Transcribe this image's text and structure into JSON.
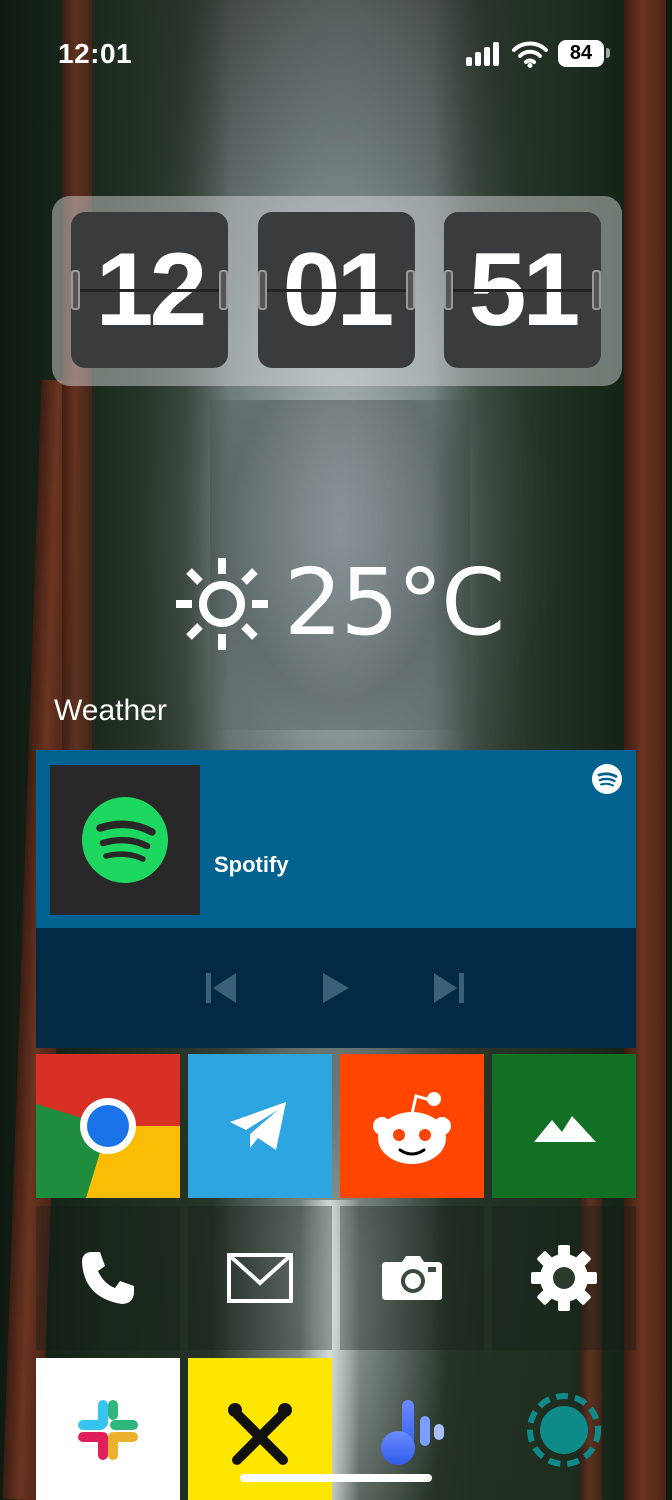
{
  "status_bar": {
    "time": "12:01",
    "battery": "84"
  },
  "flip_clock": {
    "hours": "12",
    "minutes": "01",
    "seconds": "51"
  },
  "weather": {
    "temperature": "25°C",
    "condition_icon": "sun-icon",
    "label": "Weather"
  },
  "spotify": {
    "title": "Spotify",
    "controls": [
      "previous-icon",
      "play-icon",
      "next-icon"
    ],
    "colors": {
      "header": "#02628f",
      "controls_bg": "#022a44",
      "brand": "#1ed760"
    }
  },
  "apps": [
    {
      "name": "chrome",
      "icon": "chrome-icon"
    },
    {
      "name": "telegram",
      "icon": "telegram-icon",
      "color": "#2ca5e0"
    },
    {
      "name": "reddit",
      "icon": "reddit-icon",
      "color": "#ff4500"
    },
    {
      "name": "mountains",
      "icon": "mountain-icon",
      "color": "#117024"
    },
    {
      "name": "phone",
      "icon": "phone-icon"
    },
    {
      "name": "mail",
      "icon": "mail-icon"
    },
    {
      "name": "camera",
      "icon": "camera-icon"
    },
    {
      "name": "settings",
      "icon": "gear-icon"
    },
    {
      "name": "slack",
      "icon": "slack-icon",
      "color": "#ffffff"
    },
    {
      "name": "raiffeisen",
      "icon": "raiffeisen-icon",
      "color": "#ffe600"
    },
    {
      "name": "audio-app",
      "icon": "audio-note-icon"
    },
    {
      "name": "dotted-circle-app",
      "icon": "dotted-circle-icon"
    }
  ]
}
